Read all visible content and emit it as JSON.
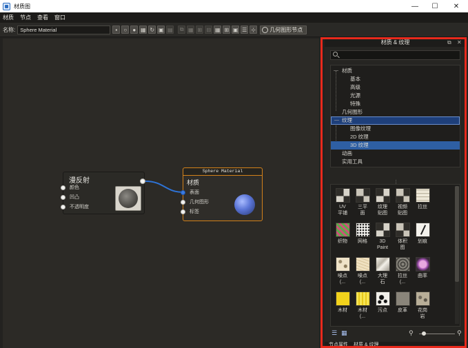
{
  "window": {
    "title": "材质图",
    "minimize": "—",
    "maximize": "☐",
    "close": "✕"
  },
  "menu": {
    "items": [
      "材质",
      "节点",
      "查看",
      "窗口"
    ]
  },
  "toolbar": {
    "name_label": "名称:",
    "name_value": "Sphere Material",
    "geometry_button_label": "几何图形节点"
  },
  "nodes": {
    "diffuse": {
      "title": "漫反射",
      "inputs": [
        "颜色",
        "凹凸",
        "不透明度"
      ]
    },
    "material": {
      "header": "Sphere Material",
      "title": "材质",
      "inputs": [
        "表面",
        "几何图形",
        "标签"
      ]
    }
  },
  "panel": {
    "title": "材质 & 纹理",
    "tree": {
      "items": [
        {
          "label": "材质",
          "level": 0,
          "twisty": "—"
        },
        {
          "label": "基本",
          "level": 1,
          "twisty": ""
        },
        {
          "label": "高级",
          "level": 1,
          "twisty": ""
        },
        {
          "label": "光源",
          "level": 1,
          "twisty": ""
        },
        {
          "label": "特殊",
          "level": 1,
          "twisty": ""
        },
        {
          "label": "几何图形",
          "level": 0,
          "twisty": ""
        },
        {
          "label": "纹理",
          "level": 0,
          "twisty": "—"
        },
        {
          "label": "图像纹理",
          "level": 1,
          "twisty": ""
        },
        {
          "label": "2D 纹理",
          "level": 1,
          "twisty": ""
        },
        {
          "label": "3D 纹理",
          "level": 1,
          "twisty": ""
        },
        {
          "label": "动画",
          "level": 0,
          "twisty": ""
        },
        {
          "label": "实用工具",
          "level": 0,
          "twisty": ""
        }
      ],
      "selected": "3D 纹理",
      "focused": "纹理"
    },
    "divider": "⋮",
    "tiles": [
      {
        "label": "UV\n平铺",
        "swatch": "checker"
      },
      {
        "label": "三平\n面",
        "swatch": "checker2"
      },
      {
        "label": "纹理\n贴图",
        "swatch": "checker"
      },
      {
        "label": "视频\n贴图",
        "swatch": "checker2"
      },
      {
        "label": "拉丝",
        "swatch": "brushed"
      },
      {
        "label": "织物",
        "swatch": "cloth"
      },
      {
        "label": "网格",
        "swatch": "mesh"
      },
      {
        "label": "3D\nPaint",
        "swatch": "checker"
      },
      {
        "label": "体积\n图",
        "swatch": "checker2"
      },
      {
        "label": "划痕",
        "swatch": "crack"
      },
      {
        "label": "噪点\n(...",
        "swatch": "noise1"
      },
      {
        "label": "噪点\n(...",
        "swatch": "noise2"
      },
      {
        "label": "大理\n石",
        "swatch": "marble"
      },
      {
        "label": "拉丝\n(...",
        "swatch": "swirl"
      },
      {
        "label": "曲率",
        "swatch": "curv"
      },
      {
        "label": "木材",
        "swatch": "wood1"
      },
      {
        "label": "木材\n(...",
        "swatch": "wood2"
      },
      {
        "label": "污点",
        "swatch": "stain"
      },
      {
        "label": "皮革",
        "swatch": "leather"
      },
      {
        "label": "花岗\n岩",
        "swatch": "granite"
      }
    ],
    "bottom_tabs": [
      "节点属性",
      "材质 & 纹理"
    ]
  },
  "colors": {
    "selection": "#2e5fa3",
    "material_node_border": "#d4821a",
    "highlight_outline": "#e8291c",
    "wire": "#2e73d6"
  }
}
